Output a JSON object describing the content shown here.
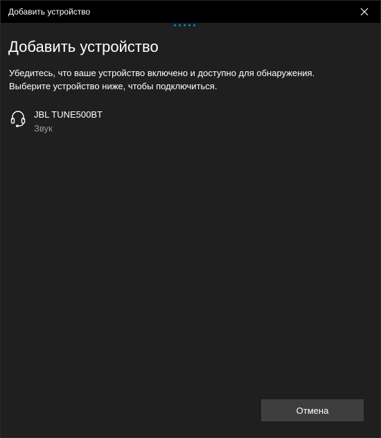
{
  "window": {
    "title": "Добавить устройство",
    "close_icon": "close-icon"
  },
  "dialog": {
    "heading": "Добавить устройство",
    "instruction_line1": "Убедитесь, что ваше устройство включено и доступно для обнаружения.",
    "instruction_line2": "Выберите устройство ниже, чтобы подключиться.",
    "progress_indicator": "searching-dots",
    "devices": [
      {
        "name": "JBL TUNE500BT",
        "type": "Звук",
        "icon": "headset-icon"
      }
    ],
    "cancel_label": "Отмена"
  },
  "colors": {
    "titlebar_bg": "#000000",
    "content_bg": "#1f1f1f",
    "accent": "#0a84d8",
    "button_bg": "#3e3e3e",
    "secondary_text": "#9a9a9a"
  }
}
